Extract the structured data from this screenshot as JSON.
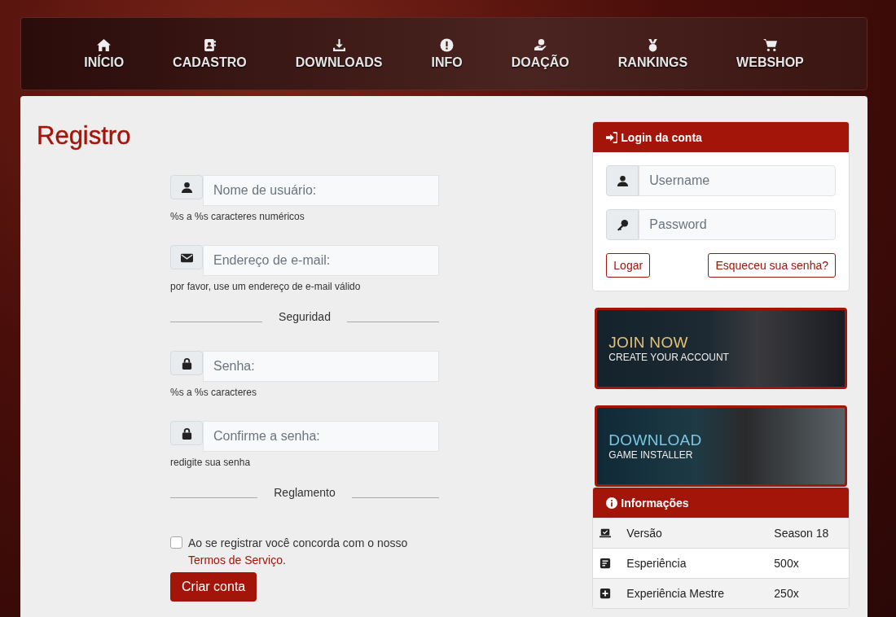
{
  "nav": [
    {
      "label": "INÍCIO"
    },
    {
      "label": "CADASTRO"
    },
    {
      "label": "DOWNLOADS"
    },
    {
      "label": "INFO"
    },
    {
      "label": "DOAÇÃO"
    },
    {
      "label": "RANKINGS"
    },
    {
      "label": "WEBSHOP"
    }
  ],
  "register": {
    "title": "Registro",
    "fields": [
      {
        "kind": "user",
        "placeholder": "Nome de usuário:",
        "hint": "%s a %s caracteres numéricos"
      },
      {
        "kind": "email",
        "placeholder": "Endereço de e-mail:",
        "hint": "por favor, use um endereço de e-mail válido"
      },
      {
        "kind": "divider",
        "label": "Seguridad"
      },
      {
        "kind": "lock",
        "placeholder": "Senha:",
        "hint": "%s a %s caracteres"
      },
      {
        "kind": "lock",
        "placeholder": "Confirme a senha:",
        "hint": "redigite sua senha"
      },
      {
        "kind": "divider",
        "label": "Reglamento"
      }
    ],
    "agree": {
      "checked": false,
      "text": "Ao se registrar você concorda com o nosso",
      "link": "Termos de Serviço",
      "end": "."
    },
    "submit": "Criar conta"
  },
  "login": {
    "title": "Login da conta",
    "fields": [
      {
        "kind": "user",
        "placeholder": "Username"
      },
      {
        "kind": "key",
        "placeholder": "Password"
      }
    ],
    "buttons": [
      "Logar",
      "Esqueceu sua senha?"
    ]
  },
  "banners": [
    {
      "title": "JOIN NOW",
      "subtitle": "CREATE YOUR ACCOUNT",
      "kind": "join"
    },
    {
      "title": "DOWNLOAD",
      "subtitle": "GAME INSTALLER",
      "kind": "download"
    }
  ],
  "info": {
    "title": "Informações",
    "rows": [
      {
        "label": "Versão",
        "value": "Season 18"
      },
      {
        "label": "Esperiência",
        "value": "500x"
      },
      {
        "label": "Experiência Mestre",
        "value": "250x"
      }
    ]
  }
}
